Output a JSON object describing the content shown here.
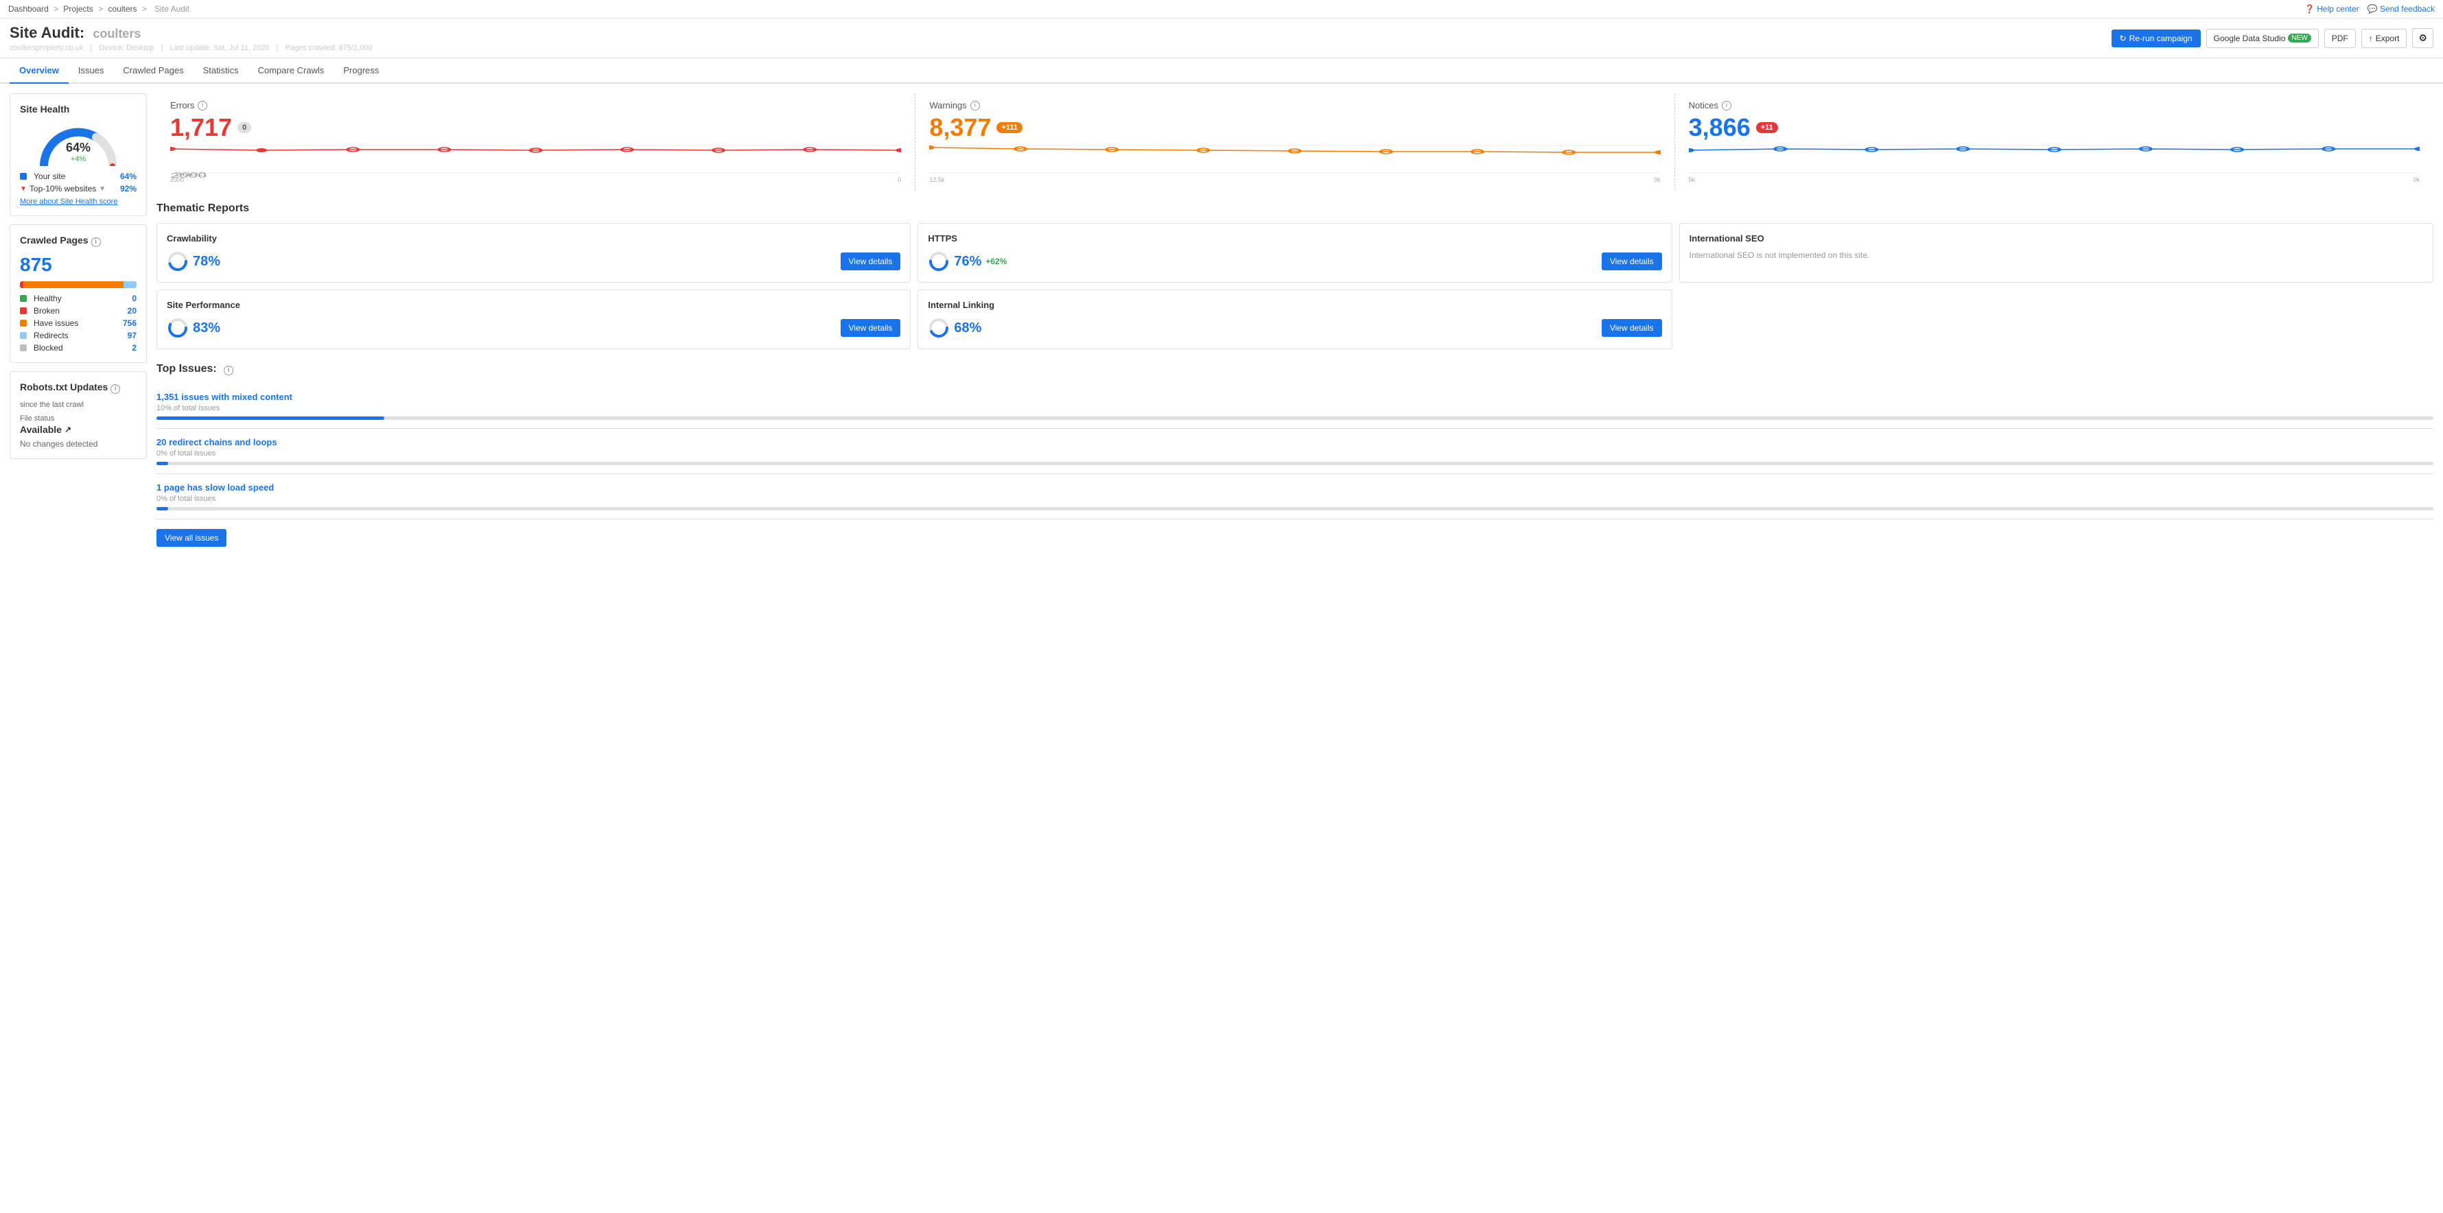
{
  "breadcrumb": {
    "items": [
      "Dashboard",
      "Projects",
      "coulters",
      "Site Audit"
    ]
  },
  "topbar": {
    "help_label": "Help center",
    "feedback_label": "Send feedback"
  },
  "header": {
    "title": "Site Audit:",
    "site_name": "coulters",
    "meta": {
      "domain": "coultersproperty.co.uk",
      "device": "Device: Desktop",
      "last_update": "Last update: Sat, Jul 11, 2020",
      "pages_crawled": "Pages crawled: 875/1,000"
    },
    "buttons": {
      "rerun": "Re-run campaign",
      "gds": "Google Data Studio",
      "gds_badge": "NEW",
      "pdf": "PDF",
      "export": "Export"
    }
  },
  "tabs": {
    "items": [
      "Overview",
      "Issues",
      "Crawled Pages",
      "Statistics",
      "Compare Crawls",
      "Progress"
    ],
    "active": "Overview"
  },
  "sidebar": {
    "site_health": {
      "title": "Site Health",
      "percentage": "64%",
      "delta": "+4%",
      "your_site_label": "Your site",
      "your_site_val": "64%",
      "top10_label": "Top-10% websites",
      "top10_val": "92%",
      "link": "More about Site Health score"
    },
    "crawled_pages": {
      "title": "Crawled Pages",
      "info_icon": "i",
      "count": "875",
      "bars": [
        {
          "color": "#e53935",
          "pct": 3
        },
        {
          "color": "#f57c00",
          "pct": 86
        },
        {
          "color": "#90caf9",
          "pct": 11
        }
      ],
      "legend": [
        {
          "color": "#34a853",
          "label": "Healthy",
          "val": "0"
        },
        {
          "color": "#e53935",
          "label": "Broken",
          "val": "20"
        },
        {
          "color": "#f57c00",
          "label": "Have issues",
          "val": "756"
        },
        {
          "color": "#90caf9",
          "label": "Redirects",
          "val": "97"
        },
        {
          "color": "#bdbdbd",
          "label": "Blocked",
          "val": "2"
        }
      ]
    },
    "robots": {
      "title": "Robots.txt Updates",
      "subtitle": "since the last crawl",
      "file_status_label": "File status",
      "status": "Available",
      "no_changes": "No changes detected"
    }
  },
  "stats": {
    "errors": {
      "label": "Errors",
      "value": "1,717",
      "badge": "0",
      "badge_type": "gray",
      "sparkline_color": "#e53935"
    },
    "warnings": {
      "label": "Warnings",
      "value": "8,377",
      "badge": "+111",
      "badge_type": "orange",
      "sparkline_color": "#f57c00"
    },
    "notices": {
      "label": "Notices",
      "value": "3,866",
      "badge": "+11",
      "badge_type": "red",
      "sparkline_color": "#1a73e8"
    }
  },
  "thematic_reports": {
    "section_title": "Thematic Reports",
    "reports": [
      {
        "title": "Crawlability",
        "pct": "78%",
        "extra": "",
        "has_btn": true,
        "btn_label": "View details",
        "no_impl": false
      },
      {
        "title": "HTTPS",
        "pct": "76%",
        "extra": "+62%",
        "has_btn": true,
        "btn_label": "View details",
        "no_impl": false
      },
      {
        "title": "International SEO",
        "pct": "",
        "extra": "",
        "has_btn": false,
        "btn_label": "",
        "no_impl": true,
        "no_impl_text": "International SEO is not implemented on this site."
      },
      {
        "title": "Site Performance",
        "pct": "83%",
        "extra": "",
        "has_btn": true,
        "btn_label": "View details",
        "no_impl": false
      },
      {
        "title": "Internal Linking",
        "pct": "68%",
        "extra": "",
        "has_btn": true,
        "btn_label": "View details",
        "no_impl": false
      }
    ]
  },
  "top_issues": {
    "section_title": "Top Issues:",
    "issues": [
      {
        "link_text": "1,351 issues with mixed content",
        "sub": "10% of total issues",
        "bar_pct": 10
      },
      {
        "link_text": "20 redirect chains and loops",
        "sub": "0% of total issues",
        "bar_pct": 0
      },
      {
        "link_text": "1 page has slow load speed",
        "sub": "0% of total issues",
        "bar_pct": 0
      }
    ],
    "view_all_label": "View all issues"
  }
}
